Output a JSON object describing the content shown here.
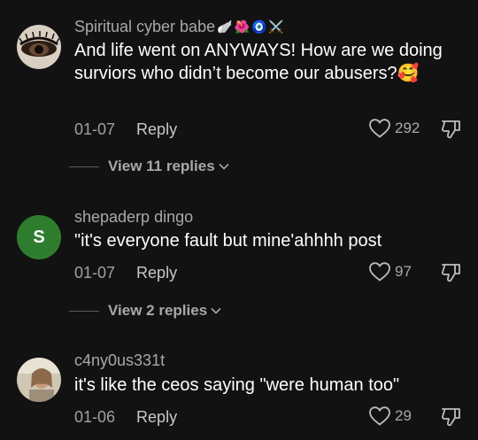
{
  "comments": [
    {
      "username": "Spiritual cyber babe",
      "badges": [
        "🪽",
        "🌺",
        "🧿",
        "⚔️"
      ],
      "text": "And life went on ANYWAYS! How are we doing surviors who didn’t become our abusers?🥰",
      "date": "01-07",
      "reply_label": "Reply",
      "likes": "292",
      "view_replies": "View 11 replies"
    },
    {
      "username": "shepaderp dingo",
      "avatar_letter": "S",
      "text": "\"it's everyone fault but mine'ahhhh post",
      "date": "01-07",
      "reply_label": "Reply",
      "likes": "97",
      "view_replies": "View 2 replies"
    },
    {
      "username": "c4ny0us331t",
      "text": "it's like the ceos saying \"were human too\"",
      "date": "01-06",
      "reply_label": "Reply",
      "likes": "29"
    }
  ],
  "colors": {
    "background": "#121212",
    "avatar_green": "#2e7d2f"
  }
}
